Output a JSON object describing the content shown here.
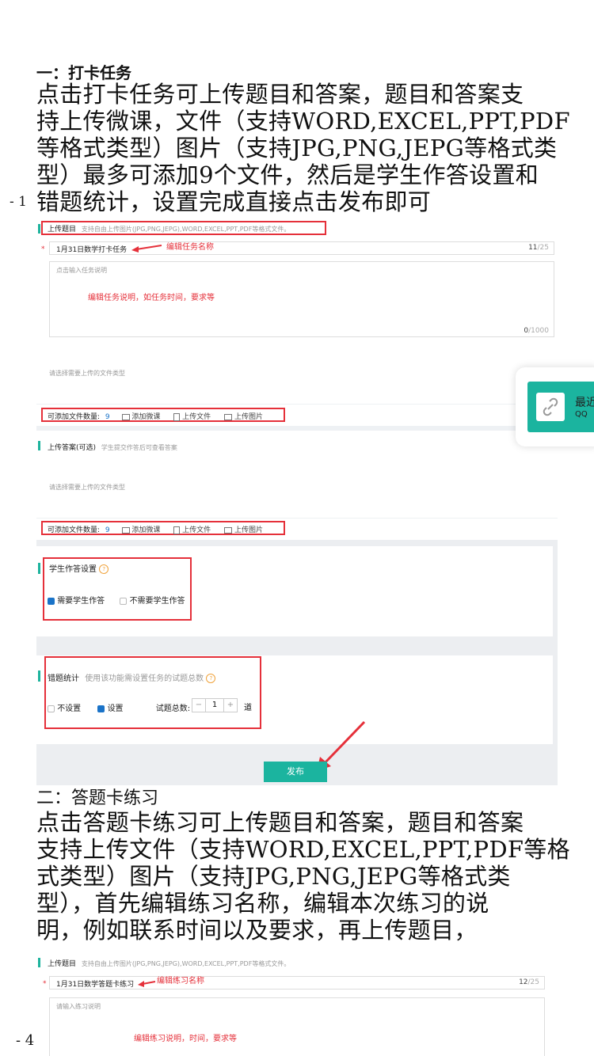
{
  "page_markers": {
    "left_top": "- 1",
    "left_bottom": "- 4 -"
  },
  "section1": {
    "heading": "一：打卡任务",
    "lines": [
      "点击打卡任务可上传题目和答案，题目和答案支",
      "持上传微课，文件（支持WORD,EXCEL,PPT,PDF",
      "等格式类型）图片（支持JPG,PNG,JEPG等格式类",
      "型）最多可添加9个文件，然后是学生作答设置和",
      "错题统计，设置完成直接点击发布即可"
    ]
  },
  "shot1": {
    "upload_title": "上传题目",
    "upload_hint": "支持自由上传图片(JPG,PNG,JEPG),WORD,EXCEL,PPT,PDF等格式文件。",
    "task_name": "1月31日数学打卡任务",
    "task_name_note": "编辑任务名称",
    "task_name_count": "11",
    "task_name_max": "/25",
    "desc_placeholder": "点击输入任务说明",
    "desc_note": "编辑任务说明，如任务时间，要求等",
    "desc_count": "0",
    "desc_max": "/1000",
    "file_type_hint": "请选择需要上传的文件类型",
    "file_count_label": "可添加文件数量:",
    "file_count": "9",
    "add_micro": "添加微课",
    "upload_file": "上传文件",
    "upload_image": "上传图片",
    "answer_title": "上传答案(可选)",
    "answer_hint": "学生提交作答后可查看答案",
    "answer_file_type_hint": "请选择需要上传的文件类型",
    "answer_file_count_label": "可添加文件数量:",
    "answer_file_count": "9",
    "answer_add_micro": "添加微课",
    "answer_upload_file": "上传文件",
    "answer_upload_image": "上传图片",
    "student_setting_title": "学生作答设置",
    "need_answer": "需要学生作答",
    "no_need_answer": "不需要学生作答",
    "error_stats_title": "错题统计",
    "error_stats_hint": "使用该功能需设置任务的试题总数",
    "not_set": "不设置",
    "set": "设置",
    "total_label": "试题总数:",
    "stepper_minus": "−",
    "stepper_value": "1",
    "stepper_plus": "+",
    "unit": "道",
    "publish": "发布"
  },
  "popup": {
    "title": "最近",
    "subtitle": "QQ"
  },
  "section2": {
    "heading": "二：答题卡练习",
    "lines": [
      "点击答题卡练习可上传题目和答案，题目和答案",
      "支持上传文件（支持WORD,EXCEL,PPT,PDF等格",
      "式类型）图片（支持JPG,PNG,JEPG等格式类",
      "型），首先编辑练习名称，编辑本次练习的说",
      "明，例如联系时间以及要求，再上传题目，"
    ]
  },
  "shot2": {
    "upload_title": "上传题目",
    "upload_hint": "支持自由上传图片(JPG,PNG,JEPG),WORD,EXCEL,PPT,PDF等格式文件。",
    "name": "1月31日数学答题卡练习",
    "name_note": "编辑练习名称",
    "name_count": "12",
    "name_max": "/25",
    "desc_placeholder": "请输入练习说明",
    "desc_note": "编辑练习说明，时间，要求等"
  },
  "colors": {
    "accent": "#1db39d",
    "annotation_red": "#e5303a",
    "checkbox_blue": "#1a73c8"
  },
  "icons": [
    "link-icon",
    "video-icon",
    "file-icon",
    "image-icon",
    "help-icon",
    "arrow-annotation-icon"
  ]
}
